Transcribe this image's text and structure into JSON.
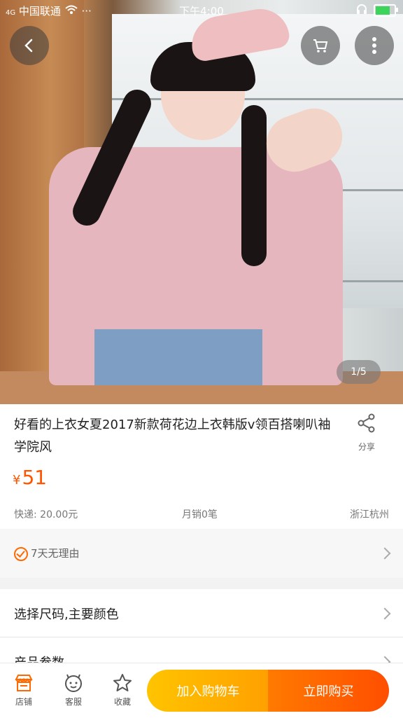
{
  "status_bar": {
    "signal_text": "4G",
    "carrier": "中国联通",
    "dots": "···",
    "time": "下午4:00"
  },
  "hero": {
    "pager": "1/5"
  },
  "product": {
    "title": "好看的上衣女夏2017新款荷花边上衣韩版v领百搭喇叭袖学院风",
    "share_label": "分享",
    "currency_symbol": "¥",
    "price": "51",
    "shipping": "快递: 20.00元",
    "monthly_sales": "月销0笔",
    "location": "浙江杭州"
  },
  "service": {
    "label": "7天无理由"
  },
  "rows": {
    "select_spec": "选择尺码,主要颜色",
    "params": "产品参数"
  },
  "bottom_bar": {
    "store": "店铺",
    "service": "客服",
    "favorite": "收藏",
    "add_to_cart": "加入购物车",
    "buy_now": "立即购买"
  },
  "colors": {
    "accent": "#ff5500",
    "cart_button": "#ffb000",
    "buy_button": "#ff5a00"
  }
}
